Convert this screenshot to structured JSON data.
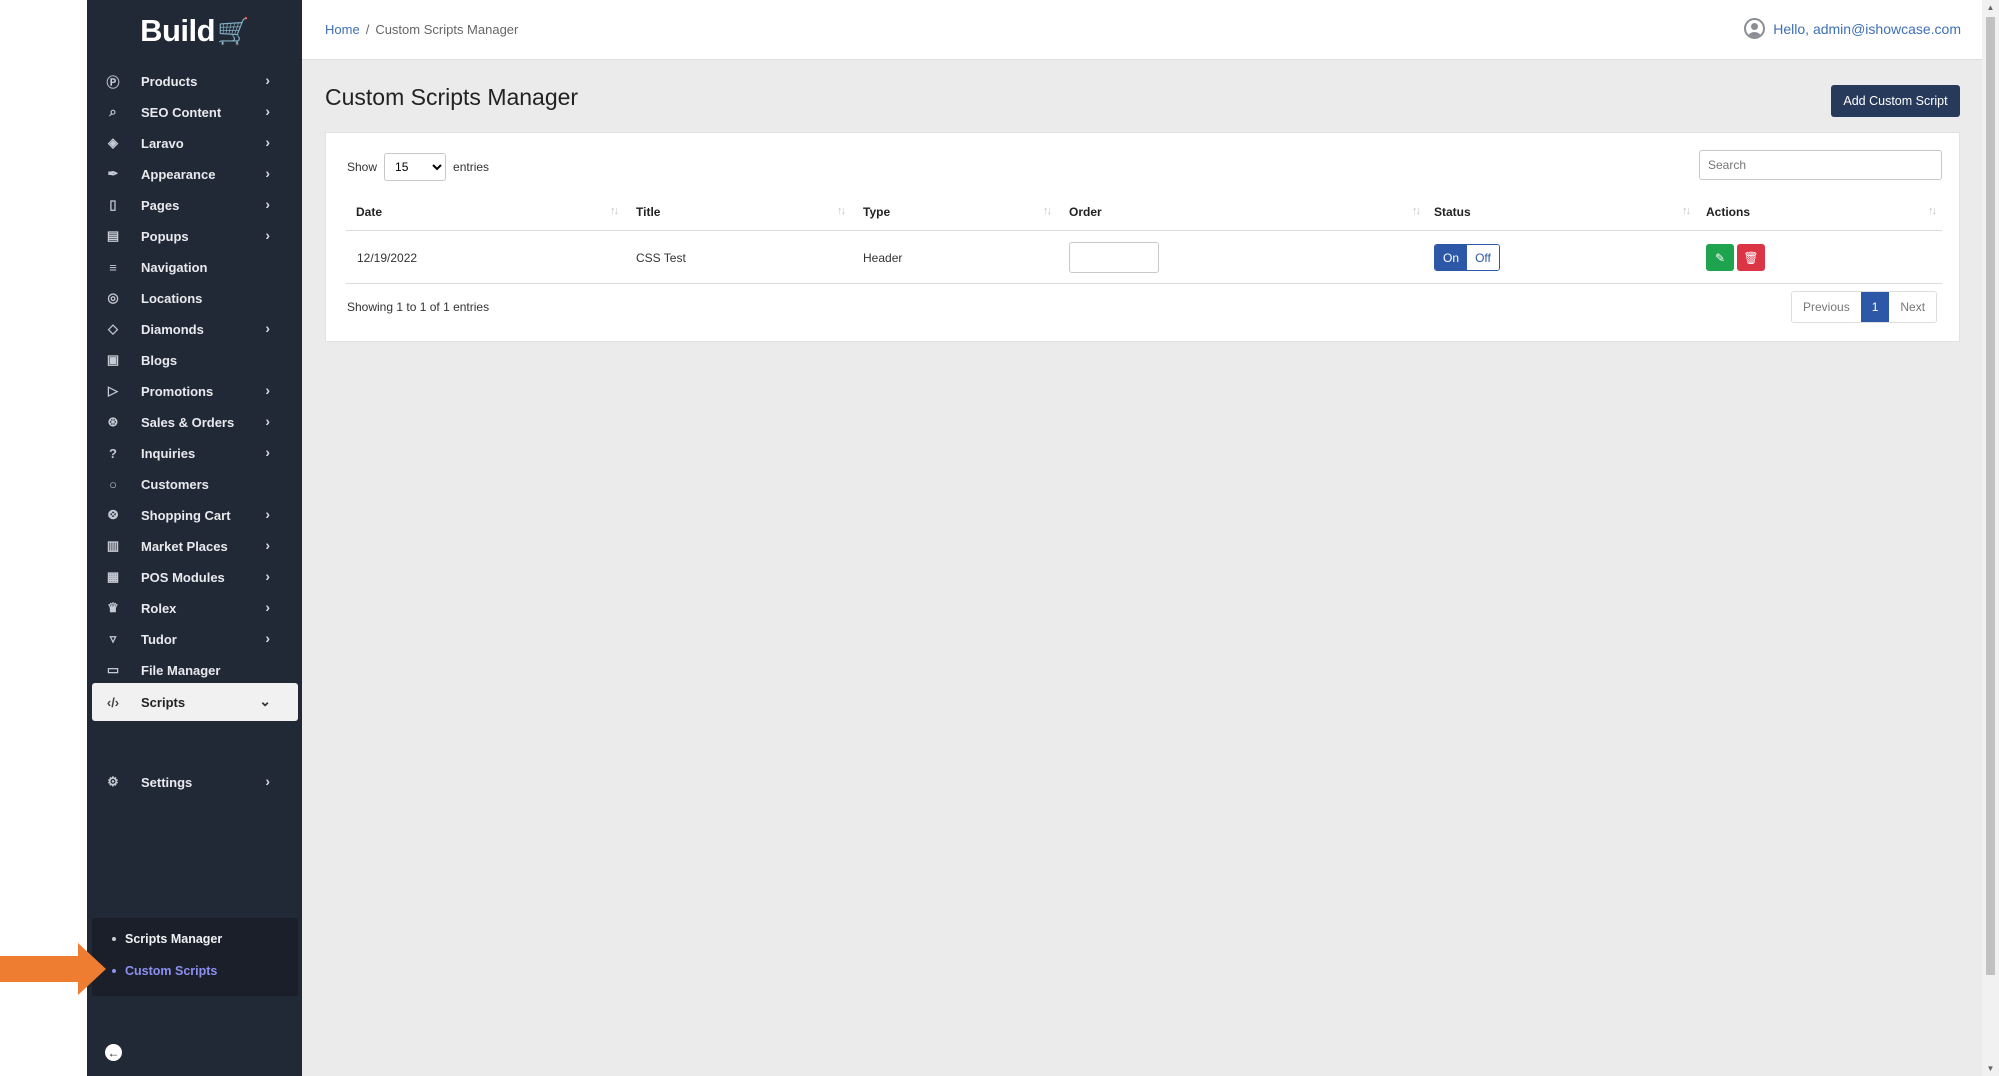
{
  "app": {
    "logo": "Build",
    "logo_icon": "cart-icon"
  },
  "sidebar": {
    "items": [
      {
        "label": "Products",
        "icon": "products-icon",
        "expandable": true
      },
      {
        "label": "SEO Content",
        "icon": "seo-icon",
        "expandable": true
      },
      {
        "label": "Laravo",
        "icon": "layers-icon",
        "expandable": true
      },
      {
        "label": "Appearance",
        "icon": "brush-icon",
        "expandable": true
      },
      {
        "label": "Pages",
        "icon": "page-icon",
        "expandable": true
      },
      {
        "label": "Popups",
        "icon": "popup-icon",
        "expandable": true
      },
      {
        "label": "Navigation",
        "icon": "menu-icon",
        "expandable": false
      },
      {
        "label": "Locations",
        "icon": "location-pin-icon",
        "expandable": false
      },
      {
        "label": "Diamonds",
        "icon": "diamond-icon",
        "expandable": true
      },
      {
        "label": "Blogs",
        "icon": "blog-icon",
        "expandable": false
      },
      {
        "label": "Promotions",
        "icon": "megaphone-icon",
        "expandable": true
      },
      {
        "label": "Sales & Orders",
        "icon": "sales-icon",
        "expandable": true
      },
      {
        "label": "Inquiries",
        "icon": "question-icon",
        "expandable": true
      },
      {
        "label": "Customers",
        "icon": "user-icon",
        "expandable": false
      },
      {
        "label": "Shopping Cart",
        "icon": "cart-icon",
        "expandable": true
      },
      {
        "label": "Market Places",
        "icon": "store-icon",
        "expandable": true
      },
      {
        "label": "POS Modules",
        "icon": "pos-icon",
        "expandable": true
      },
      {
        "label": "Rolex",
        "icon": "crown-icon",
        "expandable": true
      },
      {
        "label": "Tudor",
        "icon": "shield-icon",
        "expandable": true
      },
      {
        "label": "File Manager",
        "icon": "folder-icon",
        "expandable": false
      },
      {
        "label": "Scripts",
        "icon": "code-icon",
        "expandable": true,
        "active": true
      },
      {
        "label": "Settings",
        "icon": "gear-icon",
        "expandable": true
      }
    ],
    "submenu": [
      {
        "label": "Scripts Manager"
      },
      {
        "label": "Custom Scripts",
        "current": true
      }
    ]
  },
  "header": {
    "breadcrumb_home": "Home",
    "breadcrumb_sep": "/",
    "breadcrumb_current": "Custom Scripts Manager",
    "user_greeting": "Hello, admin@ishowcase.com"
  },
  "main": {
    "title": "Custom Scripts Manager",
    "add_button": "Add Custom Script",
    "show_label": "Show",
    "entries_value": "15",
    "entries_label": "entries",
    "search_placeholder": "Search",
    "columns": [
      "Date",
      "Title",
      "Type",
      "Order",
      "Status",
      "Actions"
    ],
    "rows": [
      {
        "date": "12/19/2022",
        "title": "CSS Test",
        "type": "Header",
        "order": "",
        "status_on": "On",
        "status_off": "Off"
      }
    ],
    "info": "Showing 1 to 1 of 1 entries",
    "pager": {
      "previous": "Previous",
      "page": "1",
      "next": "Next"
    }
  },
  "colors": {
    "sidebar_bg": "#212836",
    "primary": "#2d58a8",
    "button_dark": "#283a5b",
    "edit": "#1ea34e",
    "delete": "#dc3545",
    "arrow": "#ee7d31",
    "submenu_active": "#8d8ff1"
  }
}
